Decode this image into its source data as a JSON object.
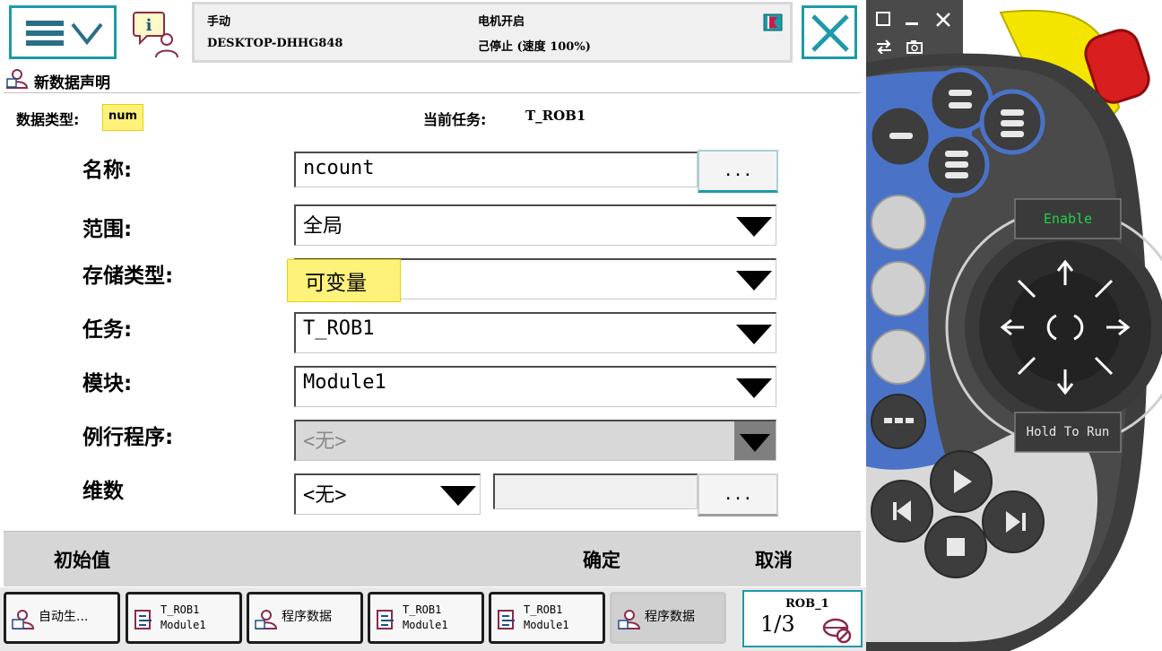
{
  "header": {
    "mode": "手动",
    "controller": "DESKTOP-DHHG848",
    "motor_status": "电机开启",
    "run_status": "己停止 (速度 100%)"
  },
  "title": "新数据声明",
  "info": {
    "type_label": "数据类型:",
    "type_value": "num",
    "task_label": "当前任务:",
    "task_value": "T_ROB1"
  },
  "form": {
    "name_label": "名称:",
    "name_value": "ncount",
    "name_btn": "...",
    "scope_label": "范围:",
    "scope_value": "全局",
    "storage_label": "存储类型:",
    "storage_value": "可变量",
    "task_label": "任务:",
    "task_value": "T_ROB1",
    "module_label": "模块:",
    "module_value": "Module1",
    "routine_label": "例行程序:",
    "routine_value": "<无>",
    "dim_label": "维数",
    "dim_value": "<无>",
    "dim_btn": "..."
  },
  "commands": {
    "initial": "初始值",
    "ok": "确定",
    "cancel": "取消"
  },
  "taskbar": {
    "tab1": "自动生...",
    "tab2_a": "T_ROB1",
    "tab2_b": "Module1",
    "tab3": "程序数据",
    "tab4_a": "T_ROB1",
    "tab4_b": "Module1",
    "tab5_a": "T_ROB1",
    "tab5_b": "Module1",
    "tab6": "程序数据",
    "quickset_name": "ROB_1",
    "quickset_value": "1/3"
  },
  "hardware": {
    "enable_label": "Enable",
    "hold_label": "Hold To Run"
  },
  "colors": {
    "accent": "#1e9aa8",
    "highlight": "#fff27a",
    "pendant_blue": "#4a73c8",
    "pendant_dark": "#3d3d3d",
    "estop_red": "#d81e1e",
    "estop_yellow": "#f4e500",
    "enable_green": "#22d24a"
  }
}
